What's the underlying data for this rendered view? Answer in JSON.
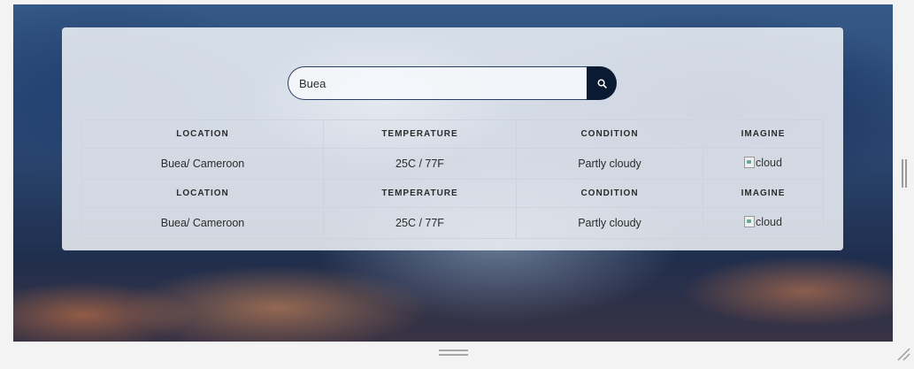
{
  "search": {
    "value": "Buea",
    "button_icon": "search-icon"
  },
  "table": {
    "headers": [
      "LOCATION",
      "TEMPERATURE",
      "CONDITION",
      "IMAGINE"
    ],
    "results": [
      {
        "location": "Buea/ Cameroon",
        "temperature": "25C / 77F",
        "condition": "Partly cloudy",
        "image_alt": "cloud"
      },
      {
        "location": "Buea/ Cameroon",
        "temperature": "25C / 77F",
        "condition": "Partly cloudy",
        "image_alt": "cloud"
      }
    ]
  },
  "colors": {
    "accent": "#0b1a33",
    "panel": "#f0f3f8"
  }
}
